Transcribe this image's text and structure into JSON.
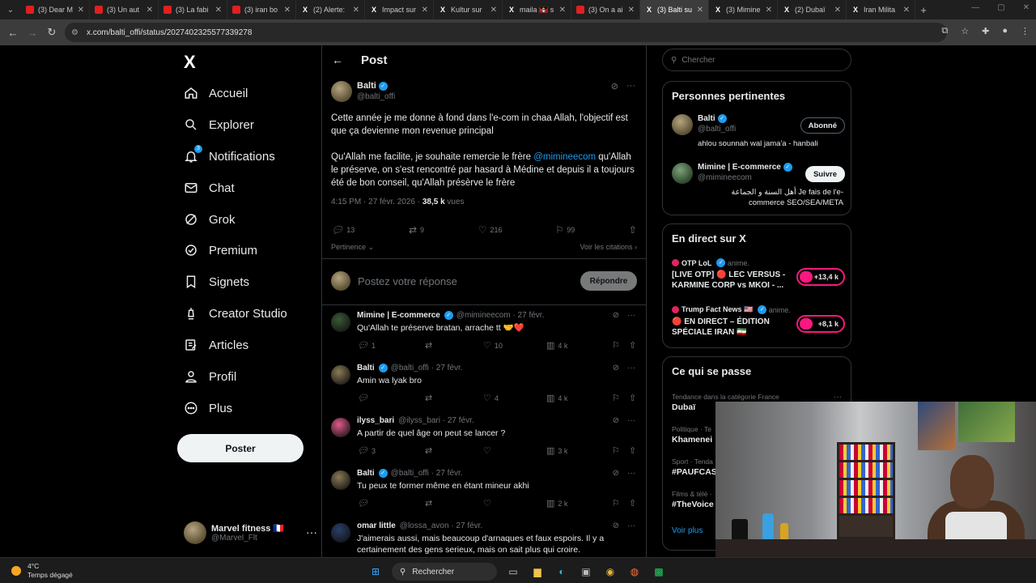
{
  "browser": {
    "tabs": [
      {
        "label": "(3) Dear M",
        "type": "yt"
      },
      {
        "label": "(3) Un aut",
        "type": "yt"
      },
      {
        "label": "(3) La fabi",
        "type": "yt"
      },
      {
        "label": "(3) iran bo",
        "type": "yt"
      },
      {
        "label": "(2) Alerte:",
        "type": "x"
      },
      {
        "label": "Impact sur",
        "type": "x"
      },
      {
        "label": "Kultur sur",
        "type": "x"
      },
      {
        "label": "maila 🇦🇬 s",
        "type": "x"
      },
      {
        "label": "(3) On a ai",
        "type": "yt"
      },
      {
        "label": "(3) Balti su",
        "type": "x",
        "active": true
      },
      {
        "label": "(3) Mimine",
        "type": "x"
      },
      {
        "label": "(2) Dubaï",
        "type": "x"
      },
      {
        "label": "Iran Milita",
        "type": "x"
      }
    ],
    "url": "x.com/balti_offi/status/2027402325577339278"
  },
  "nav": {
    "logo": "X",
    "items": [
      {
        "label": "Accueil",
        "icon": "home-icon"
      },
      {
        "label": "Explorer",
        "icon": "search-icon"
      },
      {
        "label": "Notifications",
        "icon": "bell-icon",
        "badge": "3"
      },
      {
        "label": "Chat",
        "icon": "mail-icon"
      },
      {
        "label": "Grok",
        "icon": "grok-icon"
      },
      {
        "label": "Premium",
        "icon": "verified-icon"
      },
      {
        "label": "Signets",
        "icon": "bookmark-icon"
      },
      {
        "label": "Creator Studio",
        "icon": "creator-icon"
      },
      {
        "label": "Articles",
        "icon": "article-icon"
      },
      {
        "label": "Profil",
        "icon": "person-icon"
      },
      {
        "label": "Plus",
        "icon": "more-circle-icon"
      }
    ],
    "post_button": "Poster",
    "account": {
      "name": "Marvel fitness 🇫🇷",
      "handle": "@Marvel_Flt"
    }
  },
  "main": {
    "header": "Post",
    "post": {
      "author": "Balti",
      "handle": "@balti_offi",
      "p1": "Cette année je me donne à fond dans l'e-com in chaa Allah, l'objectif est que ça devienne mon revenue principal",
      "p2_a": "Qu'Allah me facilite, je souhaite remercie le frère ",
      "mention": "@mimineecom",
      "p2_b": " qu'Allah le préserve, on s'est rencontré par hasard à Médine et depuis il a toujours été de bon conseil, qu'Allah présèrve le frère",
      "time": "4:15 PM · 27 févr. 2026 · ",
      "views": "38,5 k",
      "views_label": " vues",
      "replies": "13",
      "reposts": "9",
      "likes": "216",
      "bookmarks": "99",
      "relevance": "Pertinence",
      "quotes": "Voir les citations"
    },
    "reply_placeholder": "Postez votre réponse",
    "reply_button": "Répondre",
    "replies": [
      {
        "name": "Mimine | E-commerce",
        "handle": "@mimineecom · 27 févr.",
        "text": "Qu'Allah te préserve bratan, arrache tt 🤝❤️",
        "r": "1",
        "rt": "",
        "l": "10",
        "v": "4 k",
        "verified": true
      },
      {
        "name": "Balti",
        "handle": "@balti_offi · 27 févr.",
        "text": "Amin wa lyak bro",
        "r": "",
        "rt": "",
        "l": "4",
        "v": "4 k",
        "verified": true
      },
      {
        "name": "ilyss_bari",
        "handle": "@ilyss_bari · 27 févr.",
        "text": "A partir de quel âge on peut se lancer ?",
        "r": "3",
        "rt": "",
        "l": "",
        "v": "3 k",
        "verified": false
      },
      {
        "name": "Balti",
        "handle": "@balti_offi · 27 févr.",
        "text": "Tu peux te former même en étant mineur akhi",
        "r": "",
        "rt": "",
        "l": "",
        "v": "2 k",
        "verified": true
      },
      {
        "name": "omar little",
        "handle": "@lossa_avon · 27 févr.",
        "text": "J'aimerais aussi, mais beaucoup d'arnaques et faux espoirs. Il y a certainement des gens serieux, mais on sait plus qui croire.",
        "r": "",
        "rt": "",
        "l": "",
        "v": "",
        "verified": false
      }
    ]
  },
  "right": {
    "search_placeholder": "Chercher",
    "people_title": "Personnes pertinentes",
    "people": [
      {
        "name": "Balti",
        "handle": "@balti_offi",
        "bio": "ahlou sounnah wal jama'a - hanbali",
        "button": "Abonné"
      },
      {
        "name": "Mimine | E-commerce",
        "handle": "@mimineecom",
        "bio": "أهل السنة و الجماعة Je fais de l'e-commerce SEO/SEA/META",
        "button": "Suivre"
      }
    ],
    "live_title": "En direct sur X",
    "live": [
      {
        "source": "OTP LoL",
        "tag": "anime.",
        "title": "[LIVE OTP] 🔴 LEC VERSUS - KARMINE CORP vs MKOI - ...",
        "count": "+13,4 k"
      },
      {
        "source": "Trump Fact News 🇺🇸",
        "tag": "anime.",
        "title": "🔴 EN DIRECT – ÉDITION SPÉCIALE IRAN 🇮🇷",
        "count": "+8,1 k"
      }
    ],
    "trends_title": "Ce qui se passe",
    "trends": [
      {
        "category": "Tendance dans la catégorie France",
        "name": "Dubaï"
      },
      {
        "category": "Politique · Te",
        "name": "Khamenei"
      },
      {
        "category": "Sport · Tenda",
        "name": "#PAUFCAS"
      },
      {
        "category": "Films & télé ·",
        "name": "#TheVoice"
      }
    ],
    "see_more": "Voir plus"
  },
  "taskbar": {
    "temp": "4°C",
    "weather": "Temps dégagé",
    "search": "Rechercher"
  }
}
